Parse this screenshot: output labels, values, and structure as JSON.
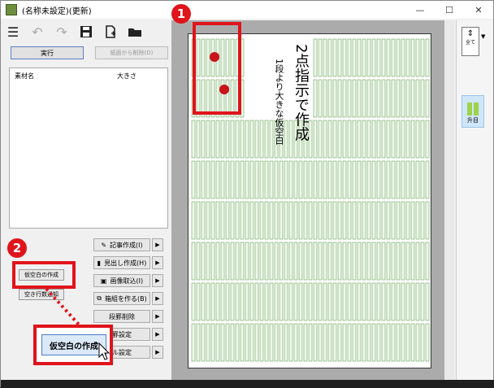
{
  "window": {
    "title": "(名称未設定)(更新)",
    "minimize": "—",
    "maximize": "☐",
    "close": "✕"
  },
  "toolbar": {
    "icons": [
      "menu-icon",
      "undo-icon",
      "redo-icon",
      "save-icon",
      "new-doc-icon",
      "open-folder-icon"
    ]
  },
  "buttons": {
    "run": "実行",
    "remove_from_page": "紙面から削除(D)"
  },
  "materials": {
    "col_name": "素材名",
    "col_size": "大きさ"
  },
  "commands": [
    {
      "label": "記事作成(I)",
      "icon": "✎"
    },
    {
      "label": "見出し作成(H)",
      "icon": "▮"
    },
    {
      "label": "画像取込(I)",
      "icon": "▣"
    },
    {
      "label": "箱組を作る(B)",
      "icon": "⧉"
    },
    {
      "label": "段罫削除",
      "icon": ""
    },
    {
      "label": "罫設定",
      "icon": ""
    },
    {
      "label": "ル設定",
      "icon": ""
    }
  ],
  "small_buttons": {
    "kara_create": "仮空白の作成",
    "empty_lines": "空き行数通知"
  },
  "callout": {
    "label": "仮空白の作成"
  },
  "badges": {
    "one": "1",
    "two": "2"
  },
  "page": {
    "headline": "2点指示で作成",
    "subheadline": "1段より大きな仮空白"
  },
  "right_pane": {
    "all_label": "全て",
    "up_label": "升目"
  },
  "colors": {
    "accent_red": "#e0141b",
    "grid_green": "#6aa25a"
  }
}
